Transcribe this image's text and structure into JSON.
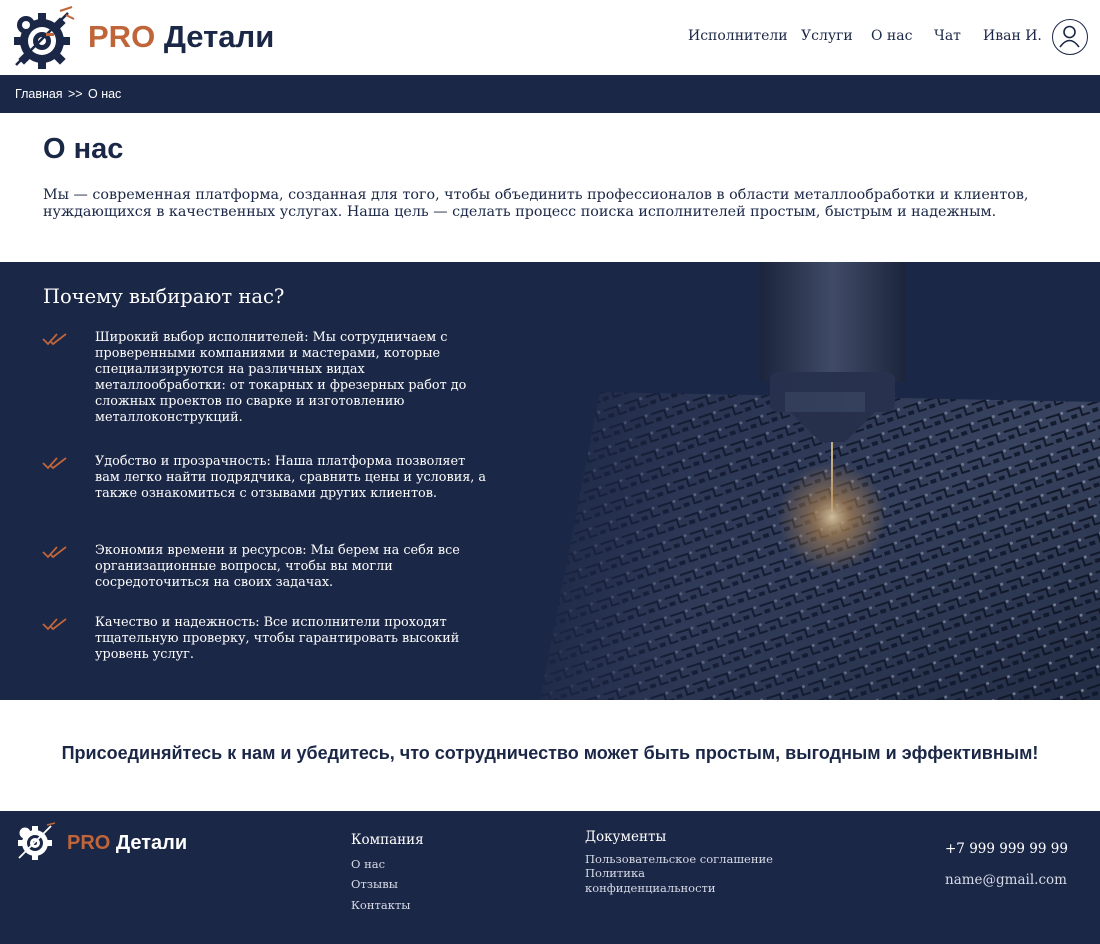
{
  "brand": {
    "pro": "PRO",
    "name": "Детали",
    "accent": "#c0653a",
    "primary": "#1b2746",
    "logo_icon": "gear-cnc-logo-icon"
  },
  "nav": {
    "items": [
      {
        "label": "Исполнители"
      },
      {
        "label": "Услуги"
      },
      {
        "label": "О нас"
      },
      {
        "label": "Чат"
      },
      {
        "label": "Иван И."
      }
    ],
    "avatar_icon": "user-circle-icon"
  },
  "breadcrumb": {
    "home": "Главная",
    "separator": ">>",
    "current": "О нас"
  },
  "intro": {
    "title": "О нас",
    "text": "Мы — современная платформа, созданная для того, чтобы объединить профессионалов в области металлообработки и клиентов, нуждающихся в качественных услугах. Наша цель — сделать процесс поиска исполнителей простым, быстрым и надежным."
  },
  "why": {
    "title": "Почему выбирают нас?",
    "check_icon": "double-check-icon",
    "items": [
      {
        "text": "Широкий выбор исполнителей: Мы сотрудничаем с проверенными компаниями и мастерами, которые специализируются на различных видах металлообработки: от токарных и фрезерных работ до сложных проектов по сварке и изготовлению металлоконструкций."
      },
      {
        "text": "Удобство и прозрачность: Наша платформа позволяет вам легко найти подрядчика, сравнить цены и условия, а также ознакомиться с отзывами других клиентов."
      },
      {
        "text": "Экономия времени и ресурсов: Мы берем на себя все организационные вопросы, чтобы вы могли сосредоточиться на своих задачах."
      },
      {
        "text": "Качество и надежность: Все исполнители проходят тщательную проверку, чтобы гарантировать высокий уровень услуг."
      }
    ]
  },
  "cta": {
    "text": "Присоединяйтесь к нам и убедитесь, что сотрудничество может быть простым, выгодным и эффективным!"
  },
  "footer": {
    "company": {
      "heading": "Компания",
      "links": [
        "О нас",
        "Отзывы",
        "Контакты"
      ]
    },
    "documents": {
      "heading": "Документы",
      "links": [
        "Пользовательское соглашение",
        "Политика конфиденциальности"
      ]
    },
    "phone": "+7 999 999 99 99",
    "email": "name@gmail.com"
  }
}
